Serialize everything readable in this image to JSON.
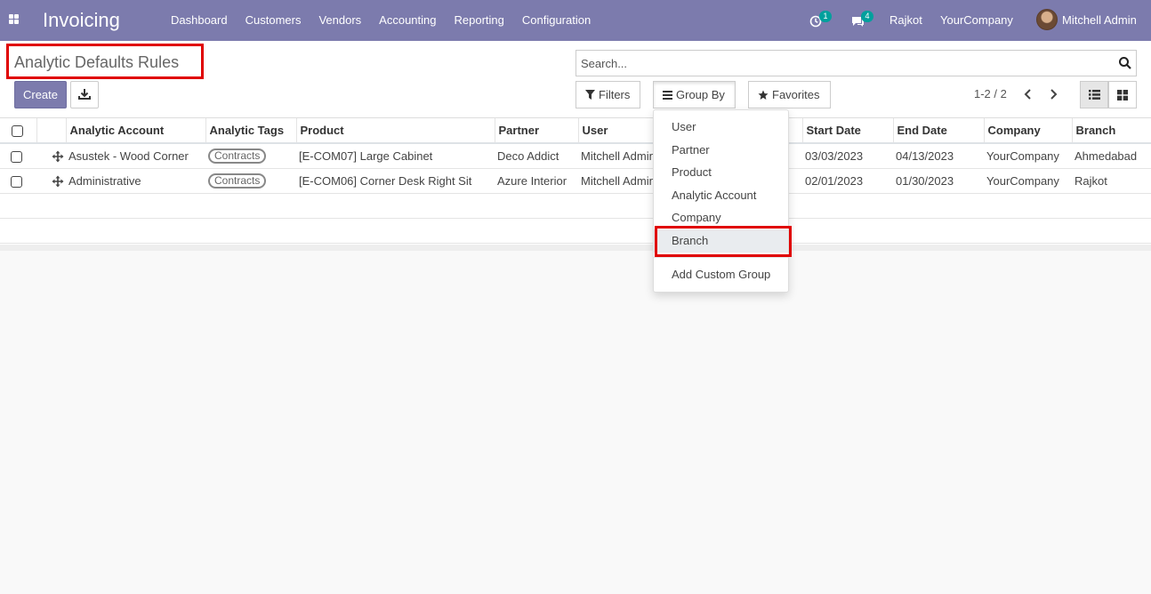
{
  "navbar": {
    "app_title": "Invoicing",
    "menu": [
      "Dashboard",
      "Customers",
      "Vendors",
      "Accounting",
      "Reporting",
      "Configuration"
    ],
    "activity_badge": "1",
    "messages_badge": "4",
    "branch": "Rajkot",
    "company": "YourCompany",
    "user": "Mitchell Admin",
    "accent_color": "#7c7bad"
  },
  "control_panel": {
    "title": "Analytic Defaults Rules",
    "create_label": "Create",
    "search_placeholder": "Search...",
    "filters_label": "Filters",
    "group_by_label": "Group By",
    "favorites_label": "Favorites",
    "pager": "1-2 / 2"
  },
  "table": {
    "columns": [
      "Analytic Account",
      "Analytic Tags",
      "Product",
      "Partner",
      "User",
      "Start Date",
      "End Date",
      "Company",
      "Branch"
    ],
    "rows": [
      {
        "analytic_account": "Asustek - Wood Corner",
        "tag": "Contracts",
        "product": "[E-COM07] Large Cabinet",
        "partner": "Deco Addict",
        "user": "Mitchell Admin",
        "start_date": "03/03/2023",
        "end_date": "04/13/2023",
        "company": "YourCompany",
        "branch": "Ahmedabad"
      },
      {
        "analytic_account": "Administrative",
        "tag": "Contracts",
        "product": "[E-COM06] Corner Desk Right Sit",
        "partner": "Azure Interior",
        "user": "Mitchell Admin",
        "start_date": "02/01/2023",
        "end_date": "01/30/2023",
        "company": "YourCompany",
        "branch": "Rajkot"
      }
    ]
  },
  "group_by_menu": {
    "options": [
      "User",
      "Partner",
      "Product",
      "Analytic Account",
      "Company",
      "Branch"
    ],
    "custom": "Add Custom Group",
    "selected": "Branch"
  }
}
